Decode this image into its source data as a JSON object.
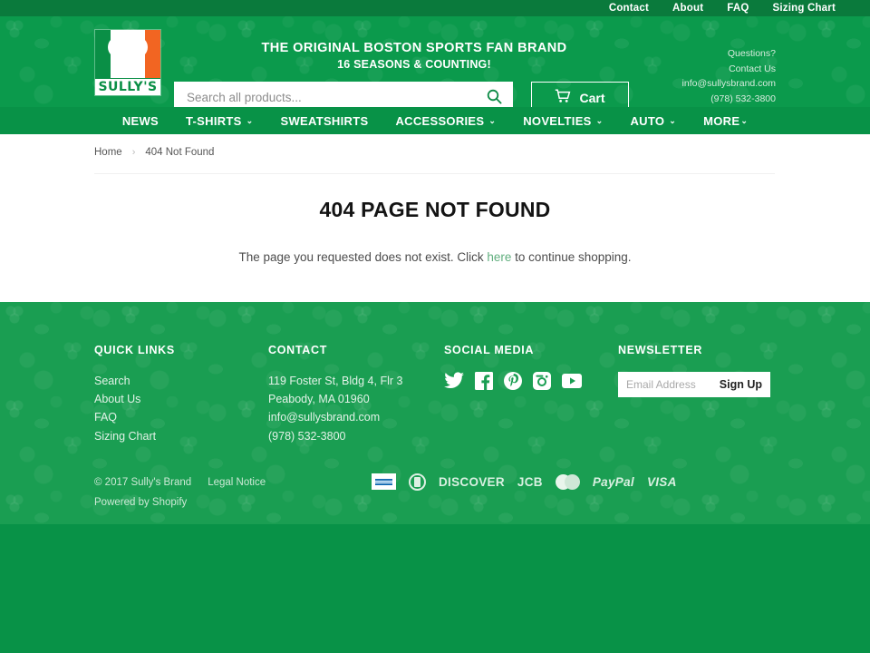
{
  "topbar": {
    "links": [
      {
        "label": "Contact"
      },
      {
        "label": "About"
      },
      {
        "label": "FAQ"
      },
      {
        "label": "Sizing Chart"
      }
    ]
  },
  "header": {
    "logo_text": "SULLY'S",
    "logo_alt": "shamrock-logo",
    "tagline_main": "THE ORIGINAL BOSTON SPORTS FAN BRAND",
    "tagline_sub": "16 SEASONS & COUNTING!",
    "search_placeholder": "Search all products...",
    "search_value": "",
    "cart_label": "Cart",
    "contact": {
      "line1": "Questions?",
      "line2": "Contact Us",
      "email": "info@sullysbrand.com",
      "phone": "(978) 532-3800"
    }
  },
  "nav": {
    "items": [
      {
        "label": "NEWS",
        "caret": "",
        "tight": false
      },
      {
        "label": "T-SHIRTS",
        "caret": "⌄",
        "tight": false
      },
      {
        "label": "SWEATSHIRTS",
        "caret": "",
        "tight": false
      },
      {
        "label": "ACCESSORIES",
        "caret": "⌄",
        "tight": false
      },
      {
        "label": "NOVELTIES",
        "caret": "⌄",
        "tight": false
      },
      {
        "label": "AUTO",
        "caret": "⌄",
        "tight": false
      },
      {
        "label": "MORE",
        "caret": "⌄",
        "tight": true
      }
    ]
  },
  "breadcrumb": {
    "home": "Home",
    "separator": "›",
    "current": "404 Not Found"
  },
  "main": {
    "title": "404 PAGE NOT FOUND",
    "body_before": "The page you requested does not exist. Click ",
    "body_link": "here",
    "body_after": " to continue shopping."
  },
  "footer": {
    "quick_links": {
      "title": "QUICK LINKS",
      "items": [
        {
          "label": "Search"
        },
        {
          "label": "About Us"
        },
        {
          "label": "FAQ"
        },
        {
          "label": "Sizing Chart"
        }
      ]
    },
    "contact": {
      "title": "CONTACT",
      "lines": [
        {
          "text": "119 Foster St, Bldg 4, Flr 3"
        },
        {
          "text": "Peabody, MA 01960"
        },
        {
          "text": "info@sullysbrand.com"
        },
        {
          "text": "(978) 532-3800"
        }
      ]
    },
    "social": {
      "title": "SOCIAL MEDIA",
      "icons": [
        {
          "name": "twitter-icon"
        },
        {
          "name": "facebook-icon"
        },
        {
          "name": "pinterest-icon"
        },
        {
          "name": "instagram-icon"
        },
        {
          "name": "youtube-icon"
        }
      ]
    },
    "newsletter": {
      "title": "NEWSLETTER",
      "placeholder": "Email Address",
      "value": "",
      "button": "Sign Up"
    },
    "bottom": {
      "copyright": "© 2017 Sully's Brand",
      "legal": "Legal Notice",
      "powered": "Powered by Shopify",
      "payments": [
        {
          "label": "American Express",
          "kind": "amex"
        },
        {
          "label": "Diners Club",
          "kind": "diners"
        },
        {
          "label": "DISCOVER",
          "kind": "text"
        },
        {
          "label": "JCB",
          "kind": "text"
        },
        {
          "label": "Mastercard",
          "kind": "mastercard"
        },
        {
          "label": "PayPal",
          "kind": "text-italic"
        },
        {
          "label": "VISA",
          "kind": "text"
        }
      ]
    }
  },
  "colors": {
    "brand_green": "#089247",
    "header_green": "#0b9a4c",
    "footer_green": "#1a9e52",
    "topbar_green": "#0a7a3c",
    "orange": "#f26522",
    "link_green": "#5fae7d"
  }
}
